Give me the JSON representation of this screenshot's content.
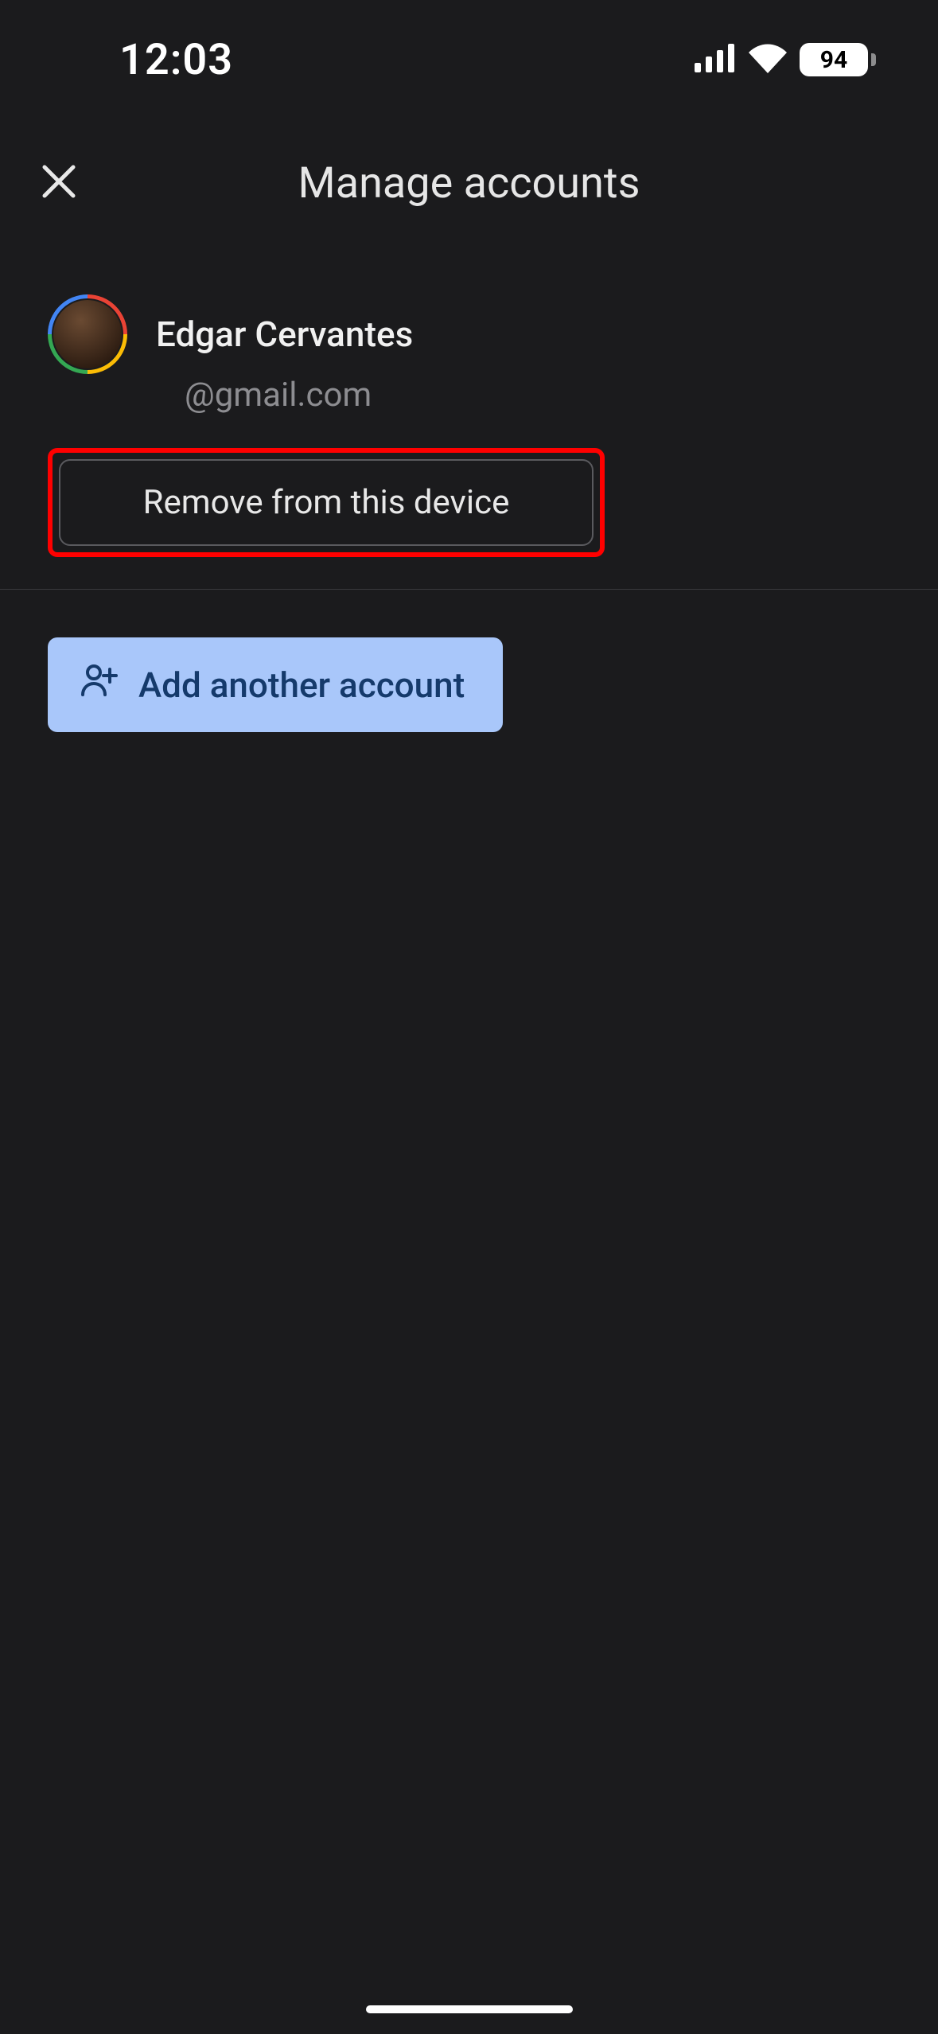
{
  "status": {
    "time": "12:03",
    "battery": "94"
  },
  "header": {
    "title": "Manage accounts"
  },
  "account": {
    "name": "Edgar Cervantes",
    "email": "@gmail.com",
    "remove_label": "Remove from this device"
  },
  "add": {
    "label": "Add another account"
  },
  "icons": {
    "close": "close-icon",
    "person_add": "person-add-icon",
    "signal": "cellular-signal-icon",
    "wifi": "wifi-icon",
    "battery": "battery-icon"
  }
}
